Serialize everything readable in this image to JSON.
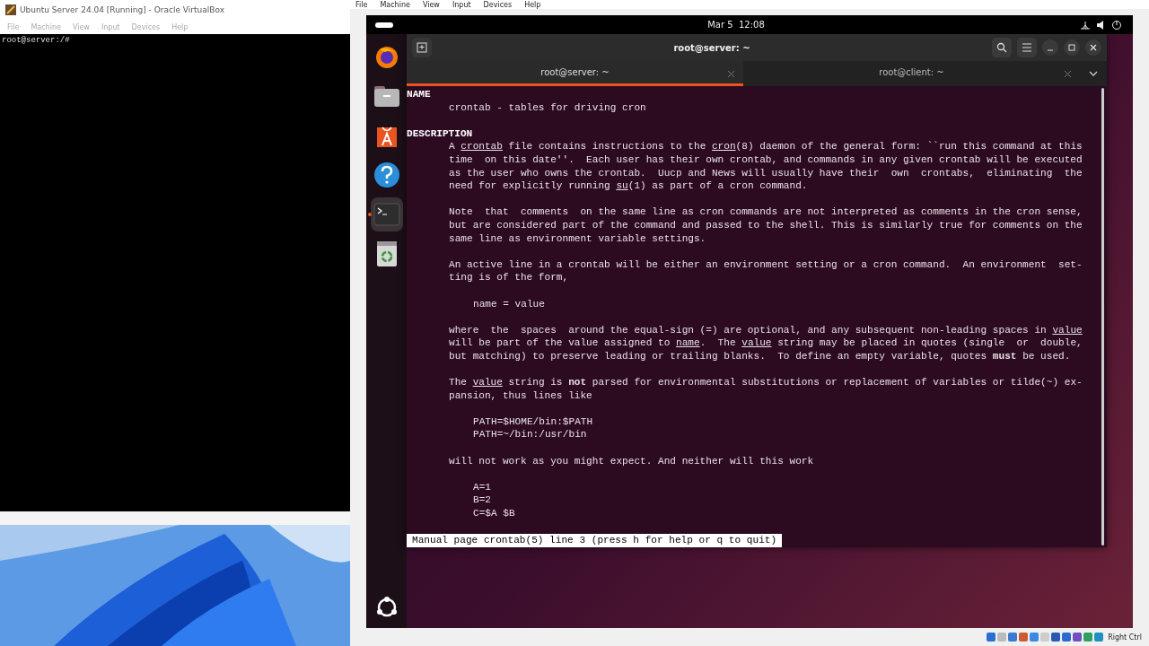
{
  "host_window": {
    "title": "Ubuntu Server 24.04 [Running] - Oracle VirtualBox",
    "menu": [
      "File",
      "Machine",
      "View",
      "Input",
      "Devices",
      "Help"
    ],
    "console_lines": [
      "root@server:/#"
    ]
  },
  "vm_window": {
    "menu": [
      "File",
      "Machine",
      "View",
      "Input",
      "Devices",
      "Help"
    ],
    "host_key": "Right Ctrl"
  },
  "ubuntu": {
    "clock": "Mar 5  12:08",
    "dock": [
      {
        "kind": "firefox",
        "selected": false
      },
      {
        "kind": "files",
        "selected": false
      },
      {
        "kind": "store",
        "selected": false
      },
      {
        "kind": "help",
        "selected": false
      },
      {
        "kind": "terminal",
        "selected": true
      },
      {
        "kind": "trash",
        "selected": false
      }
    ]
  },
  "terminal": {
    "title": "root@server: ~",
    "tabs": [
      {
        "label": "root@server: ~",
        "selected": true
      },
      {
        "label": "root@client: ~",
        "selected": false
      }
    ],
    "sections": [
      {
        "heading": "NAME",
        "paragraphs": [
          {
            "kind": "text",
            "lines": [
              "crontab - tables for driving cron"
            ]
          }
        ]
      },
      {
        "heading": "DESCRIPTION",
        "paragraphs": [
          {
            "kind": "text",
            "lines": [
              "A *crontab* file contains instructions to the *cron*(8) daemon of the general form: ``run this command at this",
              "time  on this date''.  Each user has their own crontab, and commands in any given crontab will be executed",
              "as the user who owns the crontab.  Uucp and News will usually have their  own  crontabs,  eliminating  the",
              "need for explicitly running *su*(1) as part of a cron command."
            ]
          },
          {
            "kind": "text",
            "lines": [
              "Note  that  comments  on the same line as cron commands are not interpreted as comments in the cron sense,",
              "but are considered part of the command and passed to the shell. This is similarly true for comments on the",
              "same line as environment variable settings."
            ]
          },
          {
            "kind": "text",
            "lines": [
              "An active line in a crontab will be either an environment setting or a cron command.  An environment  set‐",
              "ting is of the form,"
            ]
          },
          {
            "kind": "code",
            "lines": [
              "name = value"
            ]
          },
          {
            "kind": "text",
            "lines": [
              "where  the  spaces  around the equal-sign (=) are optional, and any subsequent non-leading spaces in *value*",
              "will be part of the value assigned to *name*.  The *value* string may be placed in quotes (single  or  double,",
              "but matching) to preserve leading or trailing blanks.  To define an empty variable, quotes **must** be used."
            ]
          },
          {
            "kind": "text",
            "lines": [
              "The *value* string is **not** parsed for environmental substitutions or replacement of variables or tilde(~) ex‐",
              "pansion, thus lines like"
            ]
          },
          {
            "kind": "code",
            "lines": [
              "PATH=$HOME/bin:$PATH",
              "PATH=~/bin:/usr/bin"
            ]
          },
          {
            "kind": "text",
            "lines": [
              "will not work as you might expect. And neither will this work"
            ]
          },
          {
            "kind": "code",
            "lines": [
              "A=1",
              "B=2",
              "C=$A $B"
            ]
          }
        ]
      }
    ],
    "status": "Manual page crontab(5) line 3 (press h for help or q to quit)"
  }
}
